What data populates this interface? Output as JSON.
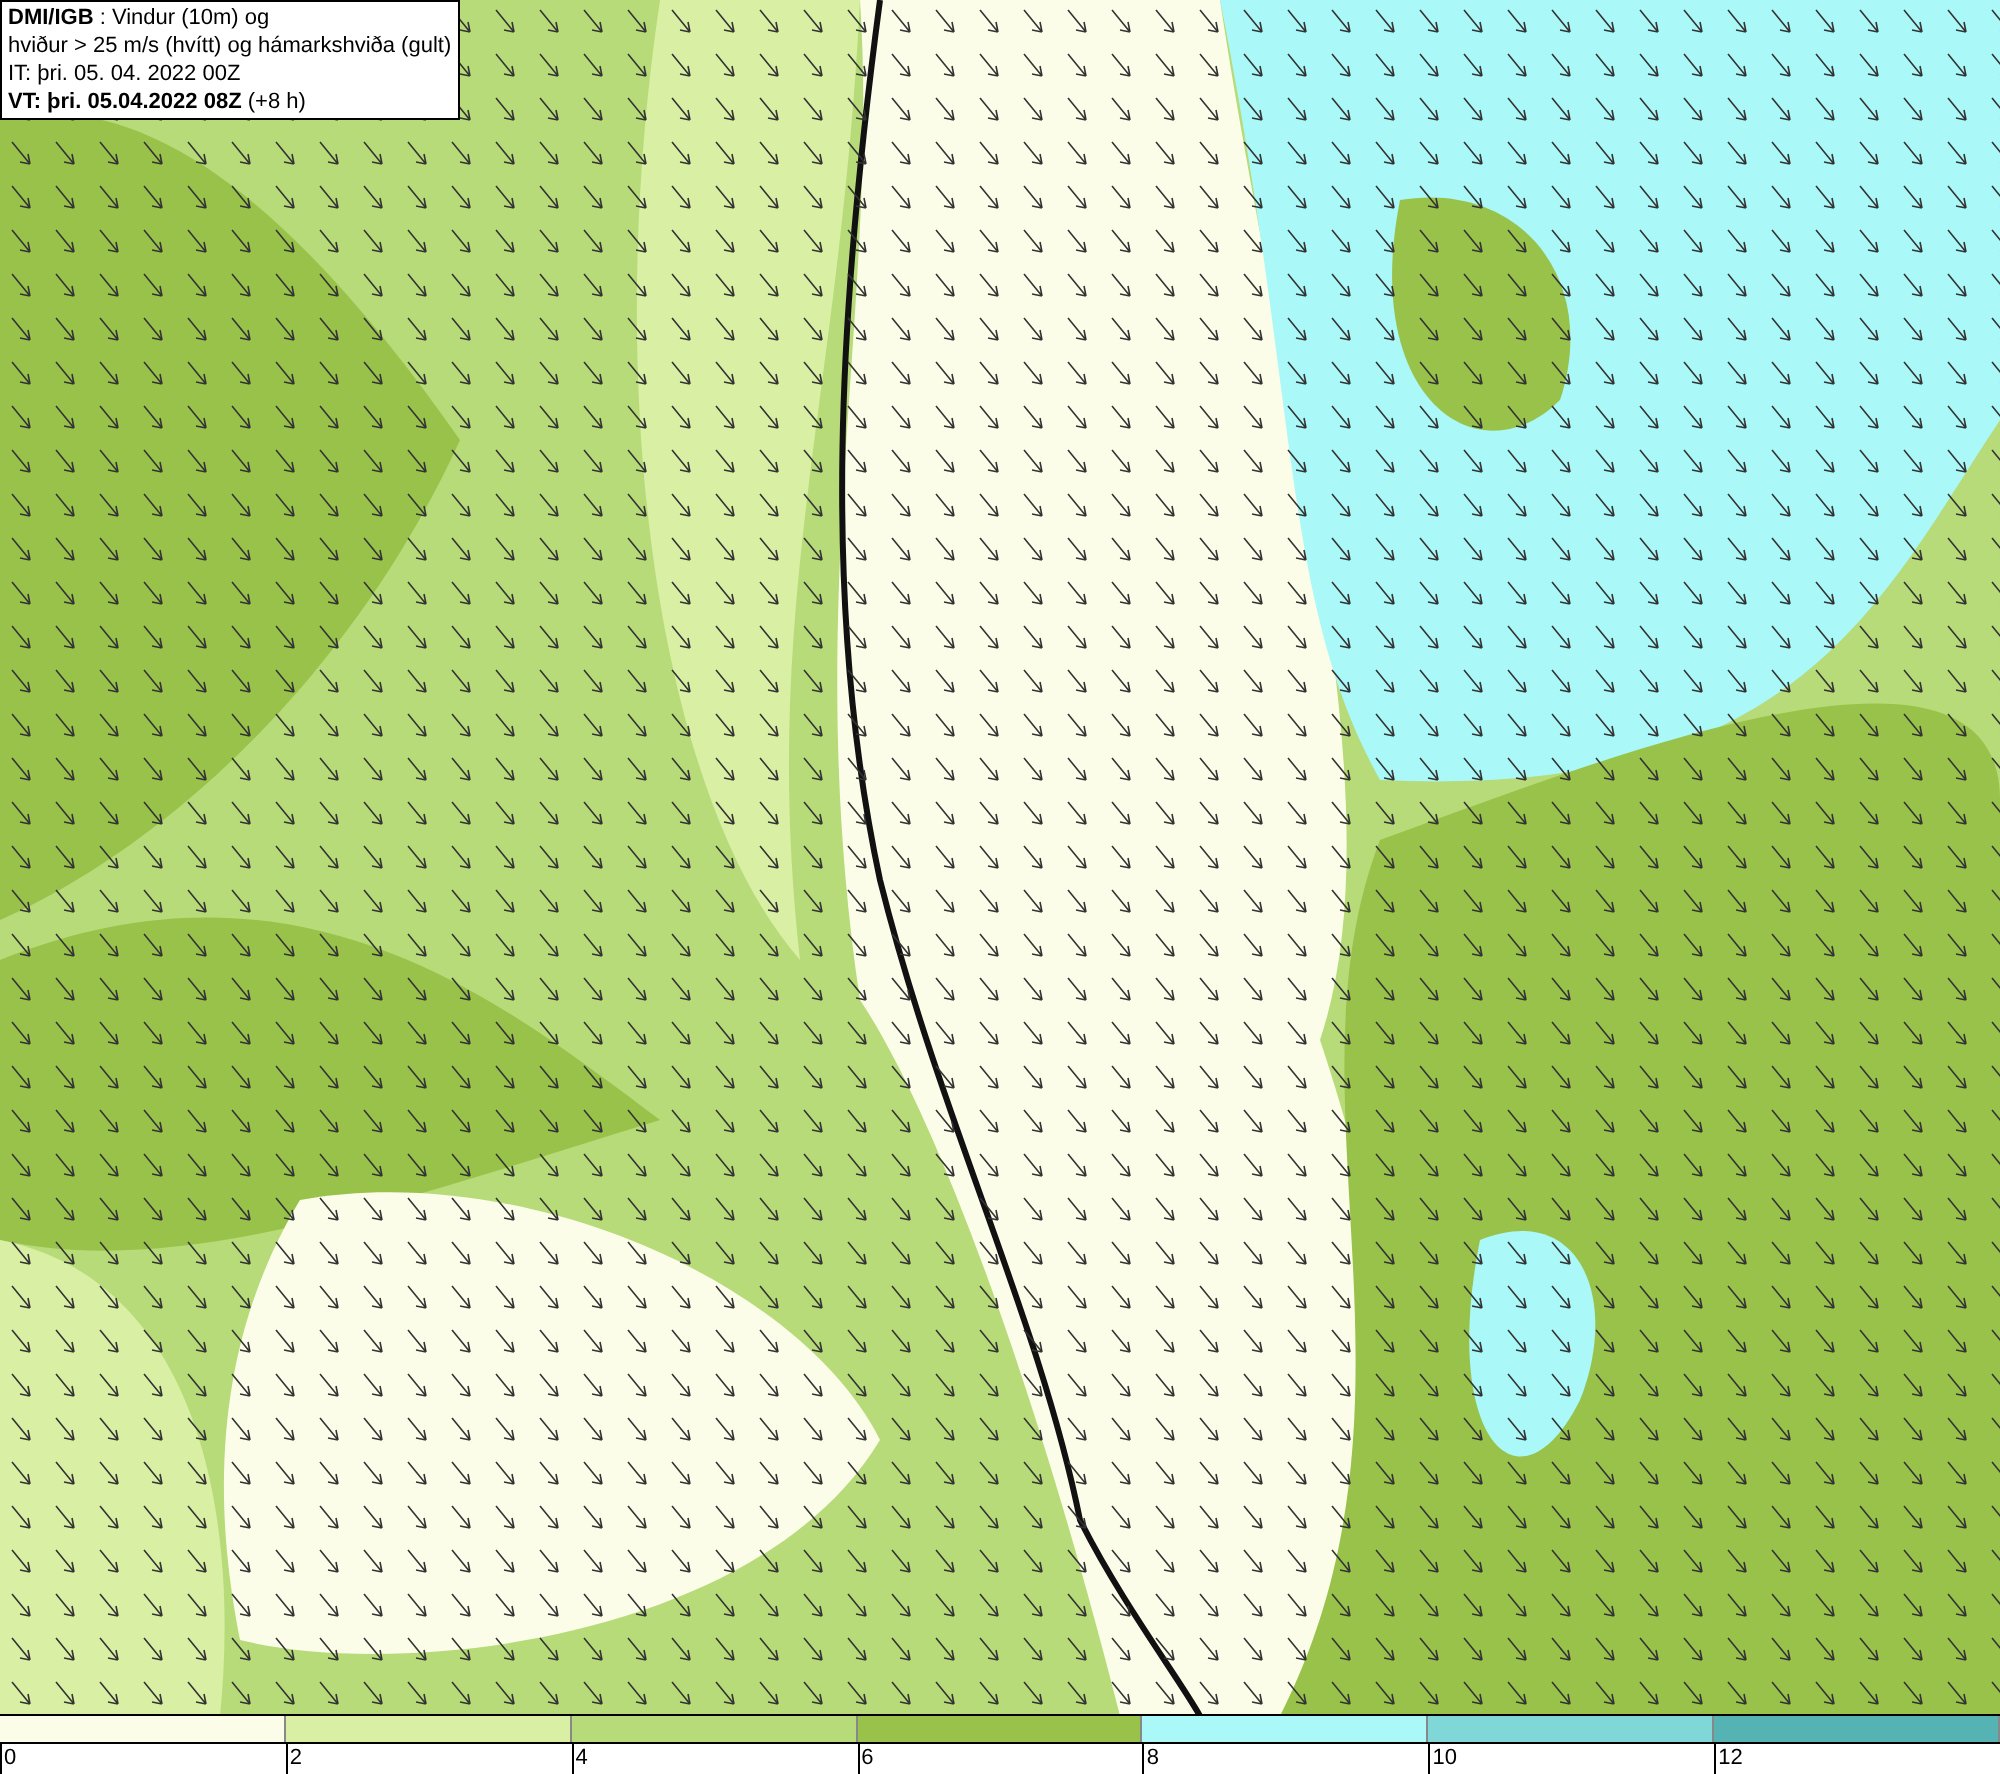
{
  "title_box": {
    "lines": [
      "**DMI/IGB** : Vindur (10m) og",
      "hviður > 25 m/s (hvítt) og hámarkshviða (gult)",
      "IT: þri. 05. 04. 2022 00Z",
      "**VT: þri. 05.04.2022 08Z** (+8 h)"
    ]
  },
  "legend": {
    "bins": [
      {
        "label": "0",
        "color": "#fbfde8"
      },
      {
        "label": "2",
        "color": "#d8efa4"
      },
      {
        "label": "4",
        "color": "#b6db78"
      },
      {
        "label": "6",
        "color": "#98c24a"
      },
      {
        "label": "8",
        "color": "#aaf8f8"
      },
      {
        "label": "10",
        "color": "#7fd7d7"
      },
      {
        "label": "12",
        "color": "#56b3b3"
      }
    ]
  }
}
